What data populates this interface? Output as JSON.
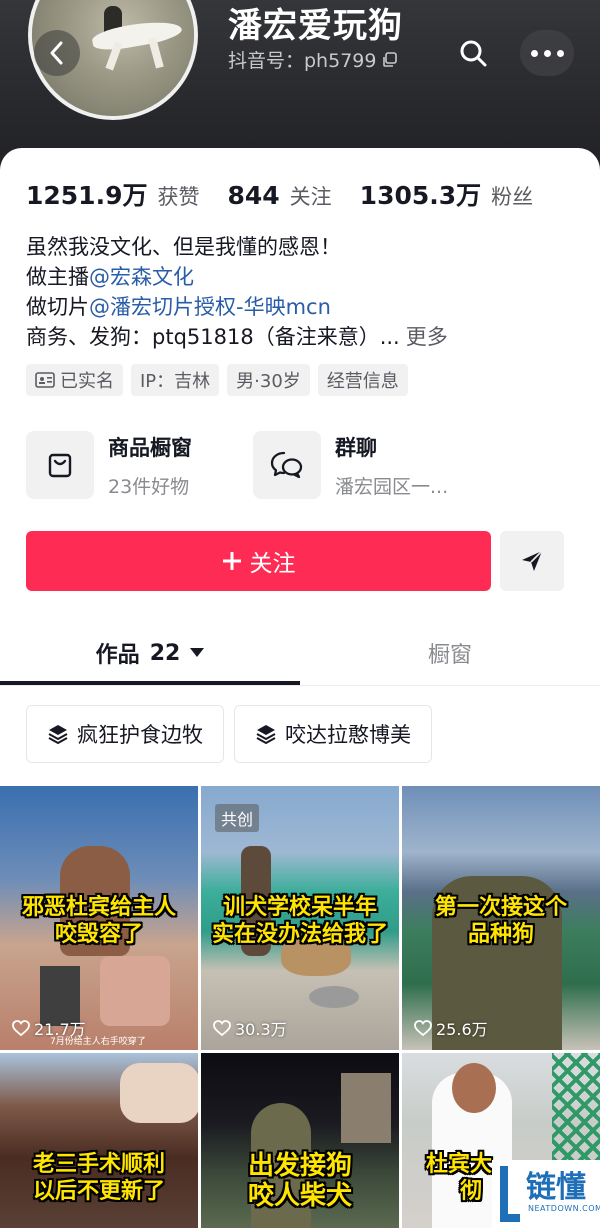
{
  "profile": {
    "name": "潘宏爱玩狗",
    "douyin_id": "抖音号：ph5799"
  },
  "stats": [
    {
      "value": "1251.9万",
      "label": "获赞"
    },
    {
      "value": "844",
      "label": "关注"
    },
    {
      "value": "1305.3万",
      "label": "粉丝"
    }
  ],
  "bio": {
    "line1": "虽然我没文化、但是我懂的感恩！",
    "line2_prefix": "做主播",
    "line2_mention": "@宏森文化",
    "line3_prefix": "做切片",
    "line3_mention": "@潘宏切片授权-华映mcn",
    "line4": "商务、发狗：ptq51818（备注来意）...",
    "more": "更多"
  },
  "tags": {
    "verified": "已实名",
    "ip": "IP：吉林",
    "gender_age": "男·30岁",
    "business": "经营信息"
  },
  "entries": {
    "shop_title": "商品橱窗",
    "shop_sub": "23件好物",
    "group_title": "群聊",
    "group_sub": "潘宏园区一..."
  },
  "actions": {
    "follow_label": "关注"
  },
  "tabs": {
    "works_label": "作品",
    "works_count": "22",
    "shop_label": "橱窗"
  },
  "collections": [
    {
      "label": "疯狂护食边牧"
    },
    {
      "label": "咬达拉憨博美"
    }
  ],
  "videos": [
    {
      "caption_line1": "邪恶杜宾给主人",
      "caption_line2": "咬毁容了",
      "likes": "21.7万",
      "subtext": "7月份给主人右手咬穿了"
    },
    {
      "caption_line1": "训犬学校呆半年",
      "caption_line2": "实在没办法给我了",
      "likes": "30.3万",
      "chip": "共创"
    },
    {
      "caption_line1": "第一次接这个",
      "caption_line2": "品种狗",
      "likes": "25.6万"
    },
    {
      "caption_line1": "老三手术顺利",
      "caption_line2": "以后不更新了"
    },
    {
      "caption_line1": "出发接狗",
      "caption_line2": "咬人柴犬"
    },
    {
      "caption_line1": "杜宾大",
      "caption_line2": "彻"
    }
  ],
  "watermark": {
    "title": "链懂",
    "sub": "NEATDOWN.COM"
  },
  "colors": {
    "accent": "#fe2c55",
    "mention": "#2a5da8",
    "caption": "#ffe500"
  }
}
